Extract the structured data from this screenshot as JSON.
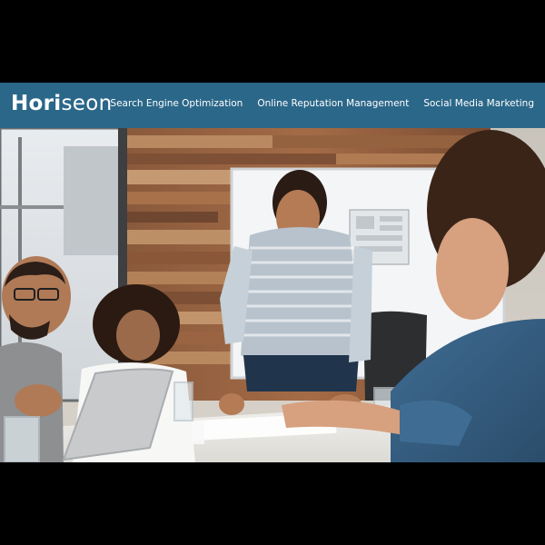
{
  "header": {
    "logo_primary": "Hori",
    "logo_secondary": "seon",
    "nav": [
      {
        "label": "Search Engine Optimization"
      },
      {
        "label": "Online Reputation Management"
      },
      {
        "label": "Social Media Marketing"
      }
    ]
  },
  "colors": {
    "header_bg": "#2b6789",
    "page_bg": "#000000",
    "header_text": "#ffffff"
  },
  "hero": {
    "image_kind": "photo"
  }
}
